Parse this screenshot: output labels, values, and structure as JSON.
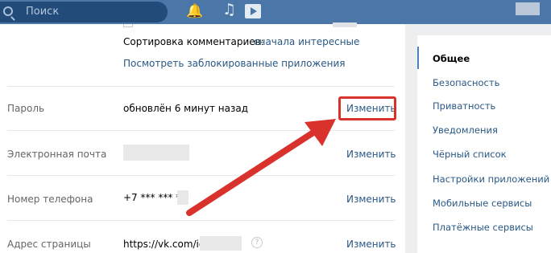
{
  "topbar": {
    "search_placeholder": "Поиск",
    "bell_icon": "🔔",
    "music_icon": "♫"
  },
  "settings": {
    "comments_sort_label": "Сортировка комментариев:",
    "comments_sort_value": "сначала интересные",
    "blocked_apps_link": "Посмотреть заблокированные приложения",
    "change_label": "Изменить",
    "rows": {
      "password": {
        "label": "Пароль",
        "value": "обновлён 6 минут назад"
      },
      "email": {
        "label": "Электронная почта"
      },
      "phone": {
        "label": "Номер телефона",
        "value": "+7 *** *** **"
      },
      "address": {
        "label": "Адрес страницы",
        "value": "https://vk.com/id"
      }
    },
    "help_mark": "?"
  },
  "sidebar": {
    "items": [
      "Общее",
      "Безопасность",
      "Приватность",
      "Уведомления",
      "Чёрный список",
      "Настройки приложений",
      "Мобильные сервисы",
      "Платёжные сервисы"
    ]
  },
  "colors": {
    "header": "#4a76a8",
    "link": "#2a5885",
    "annotation": "#d9312b"
  }
}
